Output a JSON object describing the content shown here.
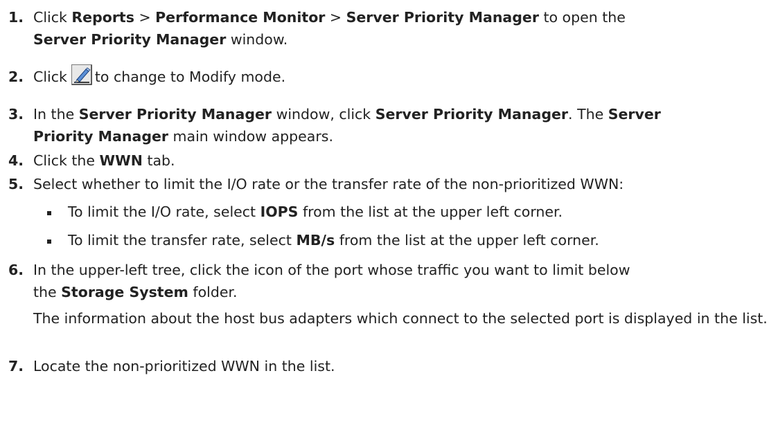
{
  "steps": [
    {
      "number": "1.",
      "parts": [
        {
          "t": "Click ",
          "b": false
        },
        {
          "t": "Reports",
          "b": true
        },
        {
          "t": " > ",
          "b": false
        },
        {
          "t": "Performance Monitor",
          "b": true
        },
        {
          "t": " > ",
          "b": false
        },
        {
          "t": "Server Priority Manager",
          "b": true
        },
        {
          "t": " to open the",
          "b": false
        },
        {
          "t": "Server Priority Manager",
          "b": true
        },
        {
          "t": " window.",
          "b": false
        }
      ]
    },
    {
      "number": "2.",
      "before_icon": "Click",
      "icon": "modify-pencil-icon",
      "after_icon": "to change to Modify mode."
    },
    {
      "number": "3.",
      "parts": [
        {
          "t": "In the ",
          "b": false
        },
        {
          "t": "Server Priority Manager",
          "b": true
        },
        {
          "t": " window, click ",
          "b": false
        },
        {
          "t": "Server Priority Manager",
          "b": true
        },
        {
          "t": ". The ",
          "b": false
        },
        {
          "t": "Server",
          "b": true
        },
        {
          "t": "Priority Manager",
          "b": true
        },
        {
          "t": " main window appears.",
          "b": false
        }
      ]
    },
    {
      "number": "4.",
      "parts": [
        {
          "t": "Click the ",
          "b": false
        },
        {
          "t": "WWN",
          "b": true
        },
        {
          "t": " tab.",
          "b": false
        }
      ]
    },
    {
      "number": "5.",
      "parts": [
        {
          "t": "Select whether to limit the I/O rate or the transfer rate of the non-prioritized WWN:",
          "b": false
        }
      ],
      "bullets": [
        [
          {
            "t": "To limit the I/O rate, select ",
            "b": false
          },
          {
            "t": "IOPS",
            "b": true
          },
          {
            "t": " from the list at the upper left corner.",
            "b": false
          }
        ],
        [
          {
            "t": "To limit the transfer rate, select ",
            "b": false
          },
          {
            "t": "MB/s",
            "b": true
          },
          {
            "t": " from the list at the upper left corner.",
            "b": false
          }
        ]
      ]
    },
    {
      "number": "6.",
      "parts": [
        {
          "t": "In the upper-left tree, click the icon of the port whose traffic you want to limit below",
          "b": false
        },
        {
          "t": "the ",
          "b": false
        },
        {
          "t": "Storage System",
          "b": true
        },
        {
          "t": " folder.",
          "b": false
        }
      ],
      "follow_up": "The information about the host bus adapters which connect to the selected port is displayed in the list."
    },
    {
      "number": "7.",
      "parts": [
        {
          "t": "Locate the non-prioritized WWN in the list.",
          "b": false
        }
      ]
    }
  ]
}
